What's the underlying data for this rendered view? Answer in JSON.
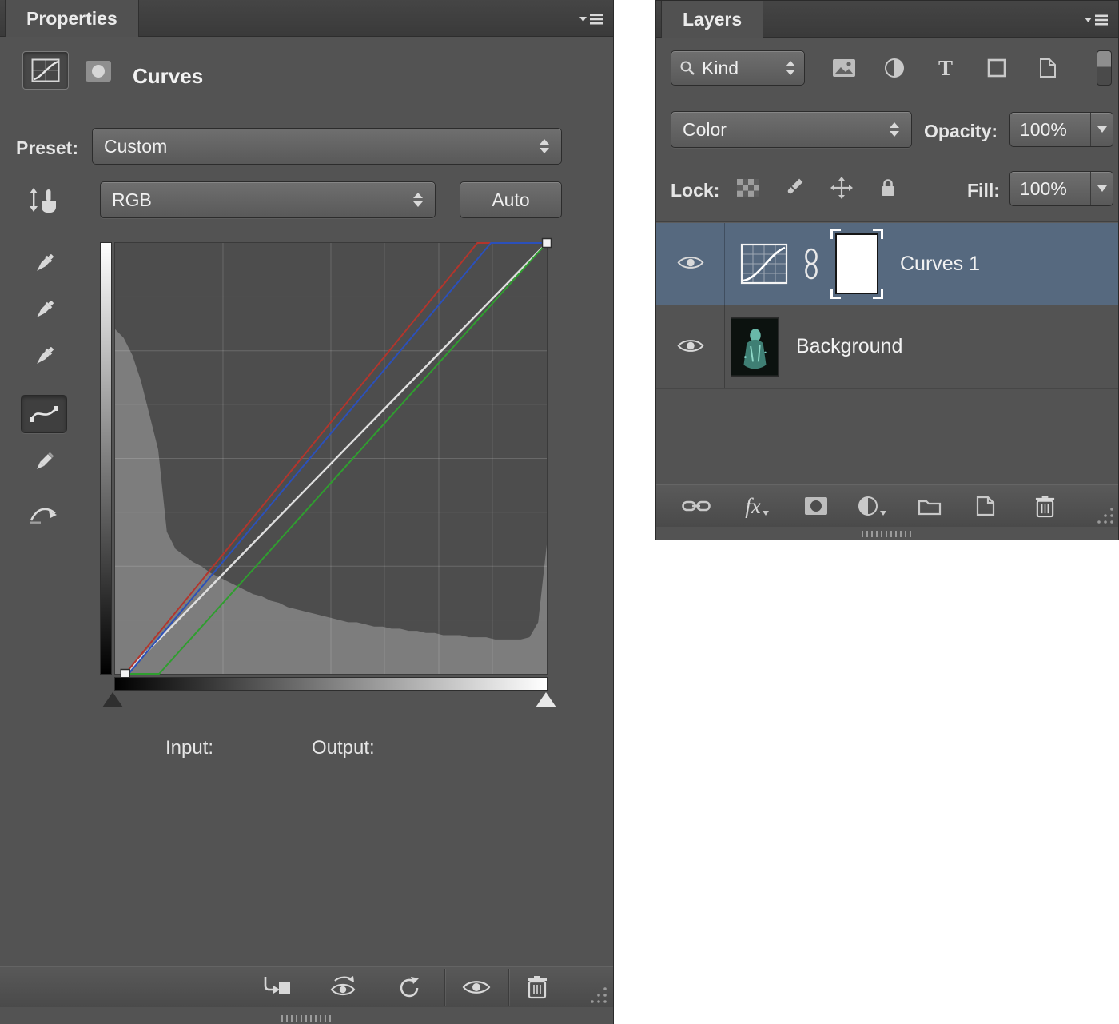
{
  "properties_panel": {
    "tab_label": "Properties",
    "title": "Curves",
    "preset_label": "Preset:",
    "preset_value": "Custom",
    "channel_value": "RGB",
    "auto_button": "Auto",
    "input_label": "Input:",
    "output_label": "Output:"
  },
  "layers_panel": {
    "tab_label": "Layers",
    "search_filter": "Kind",
    "blend_mode": "Color",
    "opacity_label": "Opacity:",
    "opacity_value": "100%",
    "lock_label": "Lock:",
    "fill_label": "Fill:",
    "fill_value": "100%",
    "fx_label": "fx",
    "type_filter_label": "T",
    "layers": [
      {
        "name": "Curves 1",
        "selected": true,
        "type": "curves-adjustment-with-mask"
      },
      {
        "name": "Background",
        "selected": false,
        "type": "image"
      }
    ]
  },
  "chart_data": {
    "type": "line",
    "title": "Curves adjustment - RGB channel curves over luminosity histogram",
    "xlabel": "Input",
    "ylabel": "Output",
    "x_range": [
      0,
      255
    ],
    "y_range": [
      0,
      255
    ],
    "grid_divisions": 8,
    "histogram_color": "#7d7d7d",
    "histogram": [
      0.8,
      0.78,
      0.74,
      0.68,
      0.6,
      0.52,
      0.33,
      0.29,
      0.275,
      0.26,
      0.25,
      0.235,
      0.225,
      0.215,
      0.205,
      0.195,
      0.185,
      0.18,
      0.17,
      0.165,
      0.155,
      0.15,
      0.145,
      0.14,
      0.135,
      0.13,
      0.125,
      0.12,
      0.12,
      0.115,
      0.11,
      0.11,
      0.105,
      0.105,
      0.1,
      0.1,
      0.095,
      0.095,
      0.09,
      0.09,
      0.09,
      0.085,
      0.085,
      0.085,
      0.08,
      0.08,
      0.08,
      0.08,
      0.085,
      0.12,
      0.3
    ],
    "series": [
      {
        "name": "baseline",
        "color": "#dedede",
        "width": 2.5,
        "points": [
          [
            6,
            0
          ],
          [
            255,
            255
          ]
        ]
      },
      {
        "name": "red",
        "color": "#b3352c",
        "width": 2,
        "points": [
          [
            6,
            0
          ],
          [
            214,
            255
          ],
          [
            255,
            255
          ]
        ]
      },
      {
        "name": "green",
        "color": "#2f9e2f",
        "width": 2,
        "points": [
          [
            6,
            0
          ],
          [
            26,
            0
          ],
          [
            255,
            255
          ]
        ]
      },
      {
        "name": "blue",
        "color": "#2b50bb",
        "width": 2,
        "points": [
          [
            8,
            0
          ],
          [
            222,
            255
          ],
          [
            255,
            255
          ]
        ]
      }
    ]
  },
  "colors": {
    "panel_bg": "#535353",
    "header_bg": "#3e3e3e",
    "selected_layer_bg": "#56697f",
    "red_channel": "#b3352c",
    "green_channel": "#2f9e2f",
    "blue_channel": "#2b50bb",
    "baseline": "#dedede",
    "histogram_fill": "#7d7d7d"
  }
}
